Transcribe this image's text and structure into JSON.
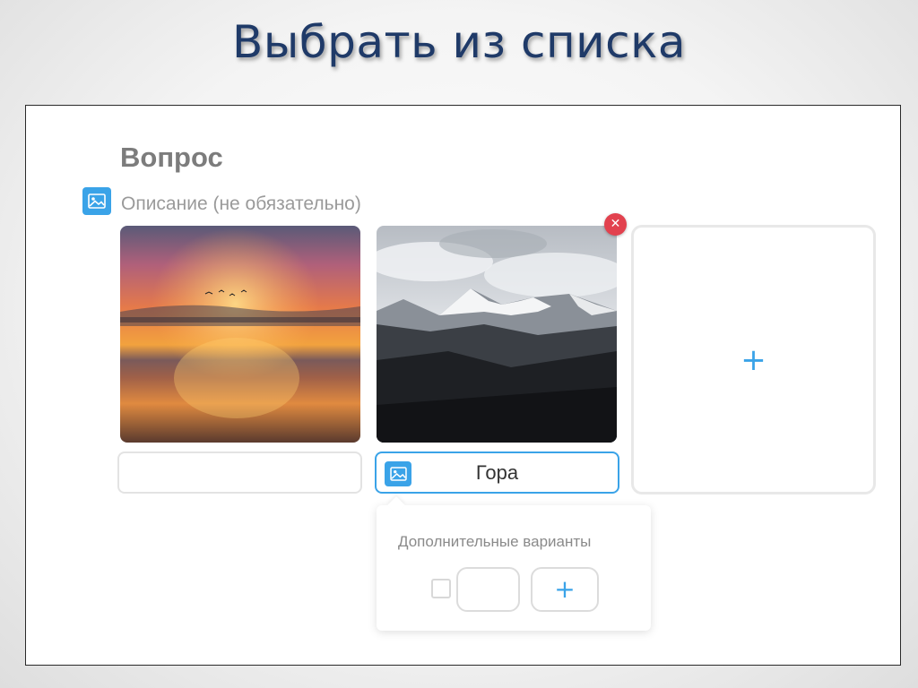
{
  "slide": {
    "title": "Выбрать из списка"
  },
  "form": {
    "question_label": "Вопрос",
    "description_placeholder": "Описание (не обязательно)"
  },
  "options": [
    {
      "image": "sunset-photo",
      "caption": ""
    },
    {
      "image": "mountain-photo",
      "caption": "Гора"
    }
  ],
  "popup": {
    "title": "Дополнительные варианты"
  },
  "icons": {
    "image": "image-icon",
    "remove": "close-icon",
    "add": "plus-icon"
  },
  "colors": {
    "accent": "#3aa3e8",
    "danger": "#e2414e",
    "title": "#1f3a68"
  }
}
